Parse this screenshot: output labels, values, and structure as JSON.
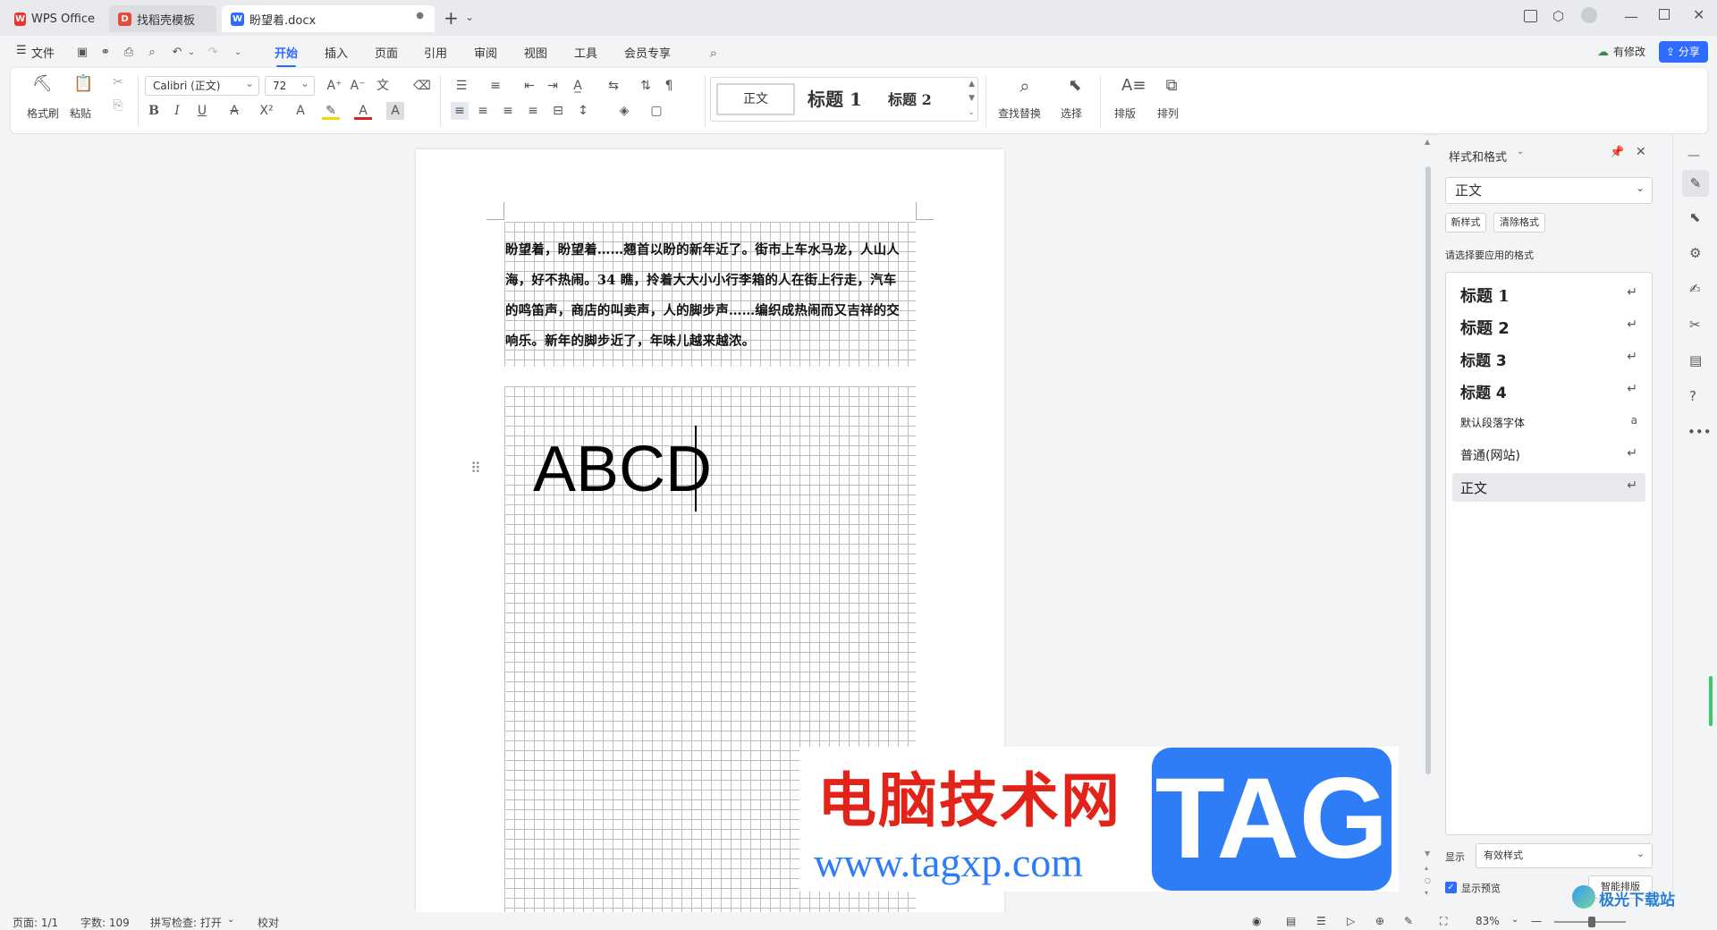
{
  "tabs": [
    {
      "label": "WPS Office",
      "icon": "wps-logo-icon"
    },
    {
      "label": "找稻壳模板",
      "icon": "docer-icon"
    },
    {
      "label": "盼望着.docx",
      "icon": "word-doc-icon"
    }
  ],
  "menu": {
    "file": "文件",
    "items": [
      "开始",
      "插入",
      "页面",
      "引用",
      "审阅",
      "视图",
      "工具",
      "会员专享"
    ],
    "active": "开始",
    "modified": "有修改",
    "share": "分享"
  },
  "ribbon": {
    "format_painter": "格式刷",
    "paste": "粘贴",
    "font_name": "Calibri (正文)",
    "font_size": "72",
    "styles": [
      "正文",
      "标题 1",
      "标题 2"
    ],
    "find_replace": "查找替换",
    "select": "选择",
    "layout": "排版",
    "arrange": "排列"
  },
  "document": {
    "lines": [
      "盼望着，盼望着……翘首以盼的新年近了。街市上车水马龙，人山人",
      "海，好不热闹。34 瞧，拎着大大小小行李箱的人在街上行走，汽车",
      "的鸣笛声，商店的叫卖声，人的脚步声……编织成热闹而又吉祥的交",
      "响乐。新年的脚步近了，年味儿越来越浓。"
    ],
    "big_text": "ABCD"
  },
  "panel": {
    "title": "样式和格式",
    "current_style": "正文",
    "new_style": "新样式",
    "clear_format": "清除格式",
    "prompt": "请选择要应用的格式",
    "styles": [
      {
        "label": "标题  1",
        "mark": "↵"
      },
      {
        "label": "标题  2",
        "mark": "↵"
      },
      {
        "label": "标题  3",
        "mark": "↵"
      },
      {
        "label": "标题 4",
        "mark": "↵"
      },
      {
        "label": "默认段落字体",
        "mark": "a"
      },
      {
        "label": "普通(网站)",
        "mark": "↵"
      },
      {
        "label": "正文",
        "mark": "↵"
      }
    ],
    "show_label": "显示",
    "show_value": "有效样式",
    "preview_label": "显示预览",
    "smart_layout": "智能排版"
  },
  "watermark": {
    "cn": "电脑技术网",
    "url": "www.tagxp.com",
    "tag": "TAG",
    "corner": "极光下载站"
  },
  "status": {
    "page": "页面: 1/1",
    "words": "字数: 109",
    "spell": "拼写检查: 打开",
    "proof": "校对",
    "zoom": "83%"
  },
  "colors": {
    "accent": "#2f6bff",
    "wps_red": "#e8372e",
    "tag_blue": "#2e7cf6"
  }
}
